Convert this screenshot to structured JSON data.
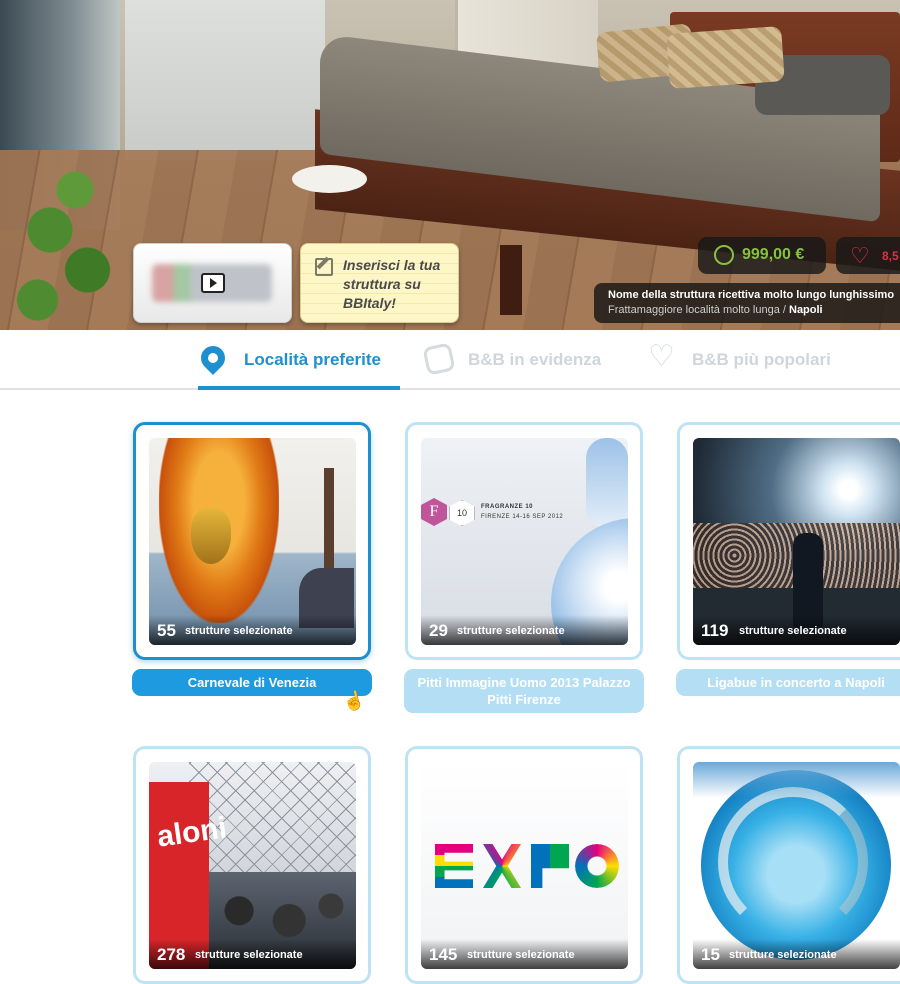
{
  "hero": {
    "promo_note_text": "Inserisci la tua struttura su BBItaly!",
    "price": "999,00 €",
    "rating": "8,5",
    "property_name": "Nome della struttura ricettiva molto lungo lunghissimo",
    "property_locality": "Frattamaggiore località molto lunga /",
    "property_city": "Napoli"
  },
  "tabs": [
    {
      "label": "Località preferite",
      "icon": "map-pin-icon",
      "active": true
    },
    {
      "label": "B&B in evidenza",
      "icon": "bb-logo-icon",
      "active": false
    },
    {
      "label": "B&B più popolari",
      "icon": "heart-icon",
      "active": false
    }
  ],
  "cards": [
    {
      "count": "55",
      "count_text": "strutture selezionate",
      "title": "Carnevale di Venezia",
      "active": true
    },
    {
      "count": "29",
      "count_text": "strutture selezionate",
      "title": "Pitti Immagine Uomo 2013 Palazzo Pitti Firenze",
      "active": false
    },
    {
      "count": "119",
      "count_text": "strutture selezionate",
      "title": "Ligabue in concerto a Napoli",
      "active": false
    },
    {
      "count": "278",
      "count_text": "strutture selezionate"
    },
    {
      "count": "145",
      "count_text": "strutture selezionate"
    },
    {
      "count": "15",
      "count_text": "strutture selezionate"
    }
  ],
  "pitti_poster": {
    "logo_letter": "F",
    "edition": "10",
    "line1": "FRAGRANZE 10",
    "line2": "FIRENZE 14-16 SEP 2012"
  },
  "salone_banner": "aloni",
  "colors": {
    "accent": "#1e8fcf",
    "inactive_tab": "#cfd6db",
    "card_border": "#bde3f4",
    "label_bg": "#b4def4",
    "price_green": "#86c23f",
    "rating_red": "#e0313b"
  }
}
